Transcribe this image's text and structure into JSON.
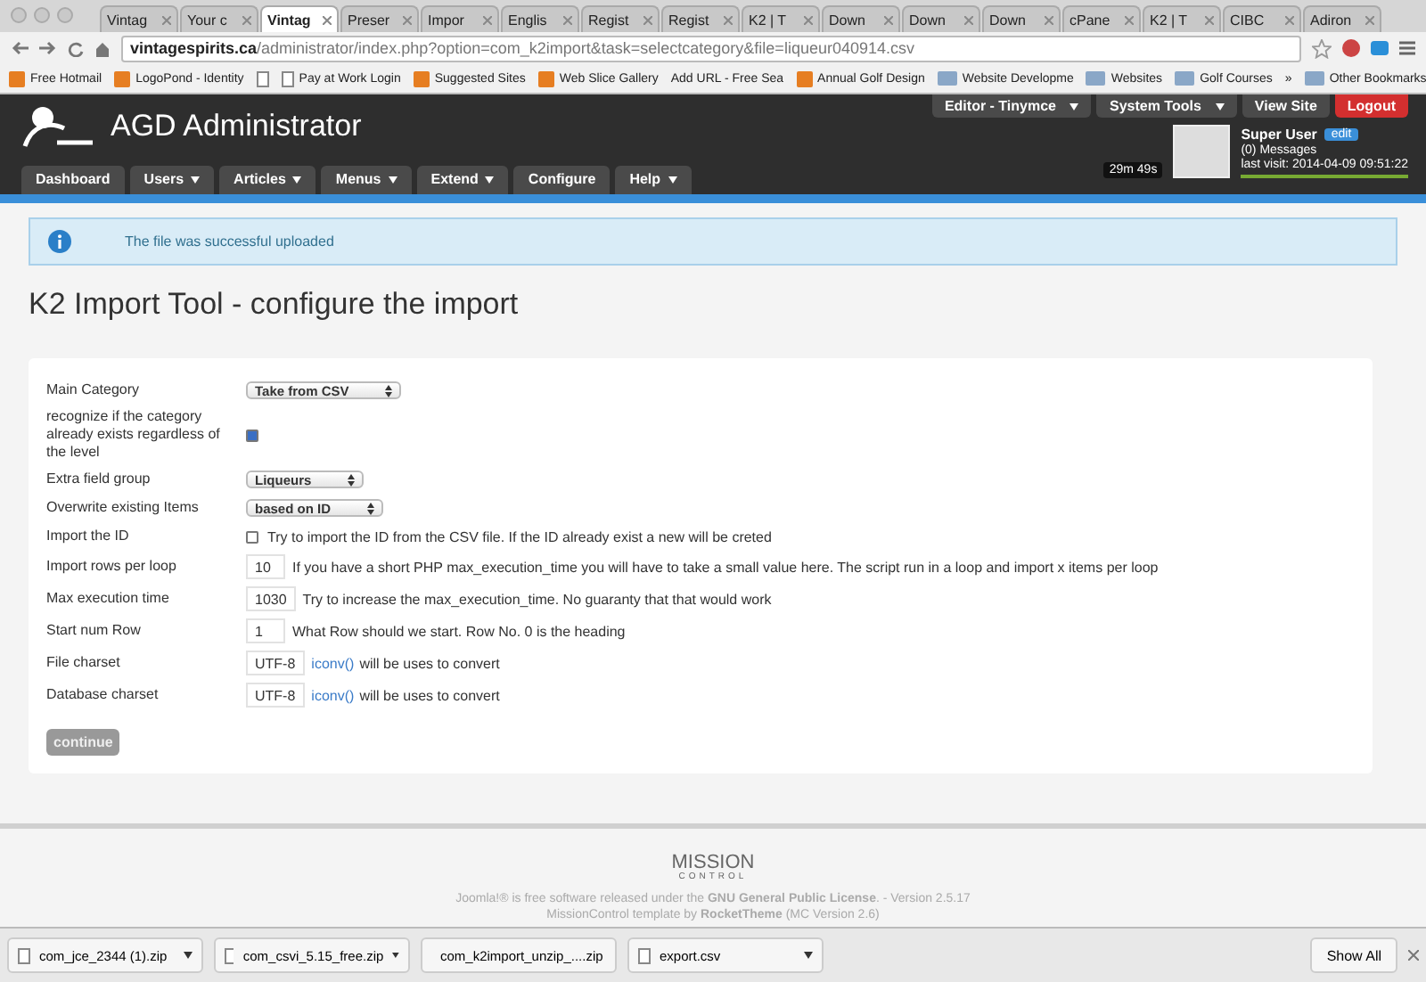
{
  "browser": {
    "tabs": [
      {
        "title": "Vintag",
        "selected": false
      },
      {
        "title": "Your c",
        "selected": false
      },
      {
        "title": "Vintag",
        "selected": true
      },
      {
        "title": "Preser",
        "selected": false
      },
      {
        "title": "Impor",
        "selected": false
      },
      {
        "title": "Englis",
        "selected": false
      },
      {
        "title": "Regist",
        "selected": false
      },
      {
        "title": "Regist",
        "selected": false
      },
      {
        "title": "K2 | T",
        "selected": false
      },
      {
        "title": "Down",
        "selected": false
      },
      {
        "title": "Down",
        "selected": false
      },
      {
        "title": "Down",
        "selected": false
      },
      {
        "title": "cPane",
        "selected": false
      },
      {
        "title": "K2 | T",
        "selected": false
      },
      {
        "title": "CIBC",
        "selected": false
      },
      {
        "title": "Adiron",
        "selected": false
      }
    ],
    "url_host": "vintagespirits.ca",
    "url_path": "/administrator/index.php?option=com_k2import&task=selectcategory&file=liqueur040914.csv",
    "bookmarks": [
      {
        "label": "Free Hotmail",
        "kind": "site"
      },
      {
        "label": "LogoPond - Identity",
        "kind": "site"
      },
      {
        "kind": "page"
      },
      {
        "label": "Pay at Work Login",
        "kind": "page"
      },
      {
        "label": "Suggested Sites",
        "kind": "site"
      },
      {
        "label": "Web Slice Gallery",
        "kind": "site"
      },
      {
        "label": "Add URL - Free Sea",
        "kind": "text"
      },
      {
        "label": "Annual Golf Design",
        "kind": "site"
      },
      {
        "label": "Website Developme",
        "kind": "folder"
      },
      {
        "label": "Websites",
        "kind": "folder"
      },
      {
        "label": "Golf Courses",
        "kind": "folder"
      }
    ],
    "more": "»",
    "other_bookmarks": "Other Bookmarks"
  },
  "header": {
    "logo_text": "AGD Administrator",
    "top_buttons": [
      {
        "label": "Editor - Tinymce",
        "dropdown": true,
        "kind": "dark"
      },
      {
        "label": "System Tools",
        "dropdown": true,
        "kind": "dark"
      },
      {
        "label": "View Site",
        "dropdown": false,
        "kind": "dark"
      },
      {
        "label": "Logout",
        "dropdown": false,
        "kind": "danger"
      }
    ],
    "menu": [
      {
        "label": "Dashboard",
        "dropdown": false
      },
      {
        "label": "Users",
        "dropdown": true
      },
      {
        "label": "Articles",
        "dropdown": true
      },
      {
        "label": "Menus",
        "dropdown": true
      },
      {
        "label": "Extend",
        "dropdown": true
      },
      {
        "label": "Configure",
        "dropdown": false
      },
      {
        "label": "Help",
        "dropdown": true
      }
    ],
    "timer": "29m 49s",
    "user": {
      "name": "Super User",
      "edit": "edit",
      "messages": "(0) Messages",
      "last_visit": "last visit: 2014-04-09 09:51:22"
    }
  },
  "message": "The file was successful uploaded",
  "page_title": "K2 Import Tool - configure the import",
  "form": {
    "rows": [
      {
        "kind": "select",
        "label": "Main Category",
        "value": "Take from CSV"
      },
      {
        "kind": "checkbox",
        "label": "recognize if the category already exists regardless of the level",
        "checked": true
      },
      {
        "kind": "select",
        "label": "Extra field group",
        "value": "Liqueurs"
      },
      {
        "kind": "select",
        "label": "Overwrite existing Items",
        "value": "based on ID"
      },
      {
        "kind": "checkbox",
        "label": "Import the ID",
        "checked": false,
        "hint": "Try to import the ID from the CSV file. If the ID already exist a new will be creted"
      },
      {
        "kind": "input",
        "label": "Import rows per loop",
        "value": "10",
        "hint": "If you have a short PHP max_execution_time you will have to take a small value here. The script run in a loop and import x items per loop"
      },
      {
        "kind": "input",
        "label": "Max execution time",
        "value": "1030",
        "hint": "Try to increase the max_execution_time. No guaranty that that would work"
      },
      {
        "kind": "input",
        "label": "Start num Row",
        "value": "1",
        "hint": "What Row should we start. Row No. 0 is the heading"
      },
      {
        "kind": "input",
        "label": "File charset",
        "value": "UTF-8",
        "link": "iconv()",
        "hint": "will be uses to convert"
      },
      {
        "kind": "input",
        "label": "Database charset",
        "value": "UTF-8",
        "link": "iconv()",
        "hint": "will be uses to convert"
      }
    ],
    "submit": "continue"
  },
  "footer": {
    "logo_text": "MISSION",
    "logo_sub": "CONTROL",
    "line1": "Joomla!® is free software released under the **GNU General Public License**. - Version 2.5.17",
    "line2": "MissionControl template by **RocketTheme** (MC Version 2.6)"
  },
  "downloads": {
    "items": [
      "com_jce_2344 (1).zip",
      "com_csvi_5.15_free.zip",
      "com_k2import_unzip_....zip",
      "export.csv"
    ],
    "show_all": "Show All"
  }
}
